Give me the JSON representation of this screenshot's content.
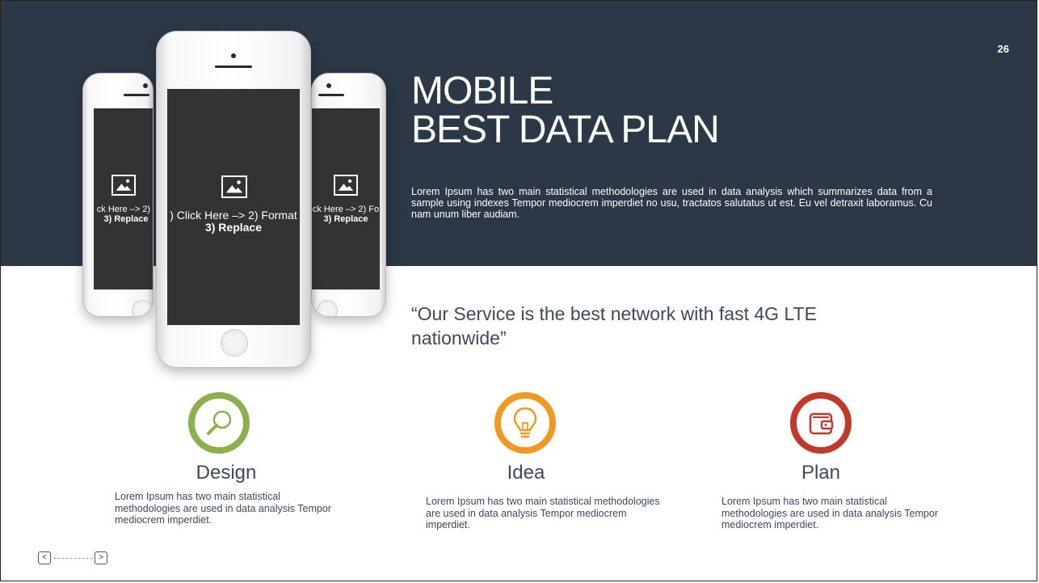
{
  "slide": {
    "page_number": "26",
    "title_line1": "MOBILE",
    "title_line2": "BEST DATA PLAN",
    "description": "Lorem Ipsum has two main statistical methodologies are used in data analysis which summarizes data from a sample using indexes Tempor mediocrem imperdiet no usu, tractatos salutatus ut est. Eu vel detraxit laboramus. Cu nam unum liber audiam.",
    "quote": "“Our Service is the best network with fast 4G LTE nationwide”"
  },
  "phones": {
    "left": {
      "line1": "ck Here –> 2) I",
      "line2": "3) Replace",
      "icon": "image-placeholder-icon"
    },
    "center": {
      "line1": ") Click Here –> 2) Format",
      "line2": "3) Replace",
      "icon": "image-placeholder-icon"
    },
    "right": {
      "line1": "ck Here –> 2) Fo",
      "line2": "3) Replace",
      "icon": "image-placeholder-icon"
    }
  },
  "features": [
    {
      "title": "Design",
      "text": "Lorem Ipsum has two main statistical methodologies are used in data analysis Tempor mediocrem imperdiet.",
      "icon": "magnifier-icon",
      "color": "#8db04e"
    },
    {
      "title": "Idea",
      "text": "Lorem Ipsum has two main statistical methodologies are used in data analysis Tempor mediocrem imperdiet.",
      "icon": "lightbulb-icon",
      "color": "#f09a24"
    },
    {
      "title": "Plan",
      "text": "Lorem Ipsum has two main statistical methodologies are used in data analysis Tempor mediocrem imperdiet.",
      "icon": "wallet-icon",
      "color": "#c0392b"
    }
  ],
  "nav": {
    "prev": "<",
    "next": ">"
  },
  "colors": {
    "band": "#2c3846",
    "text_dark": "#3d4a5c"
  }
}
